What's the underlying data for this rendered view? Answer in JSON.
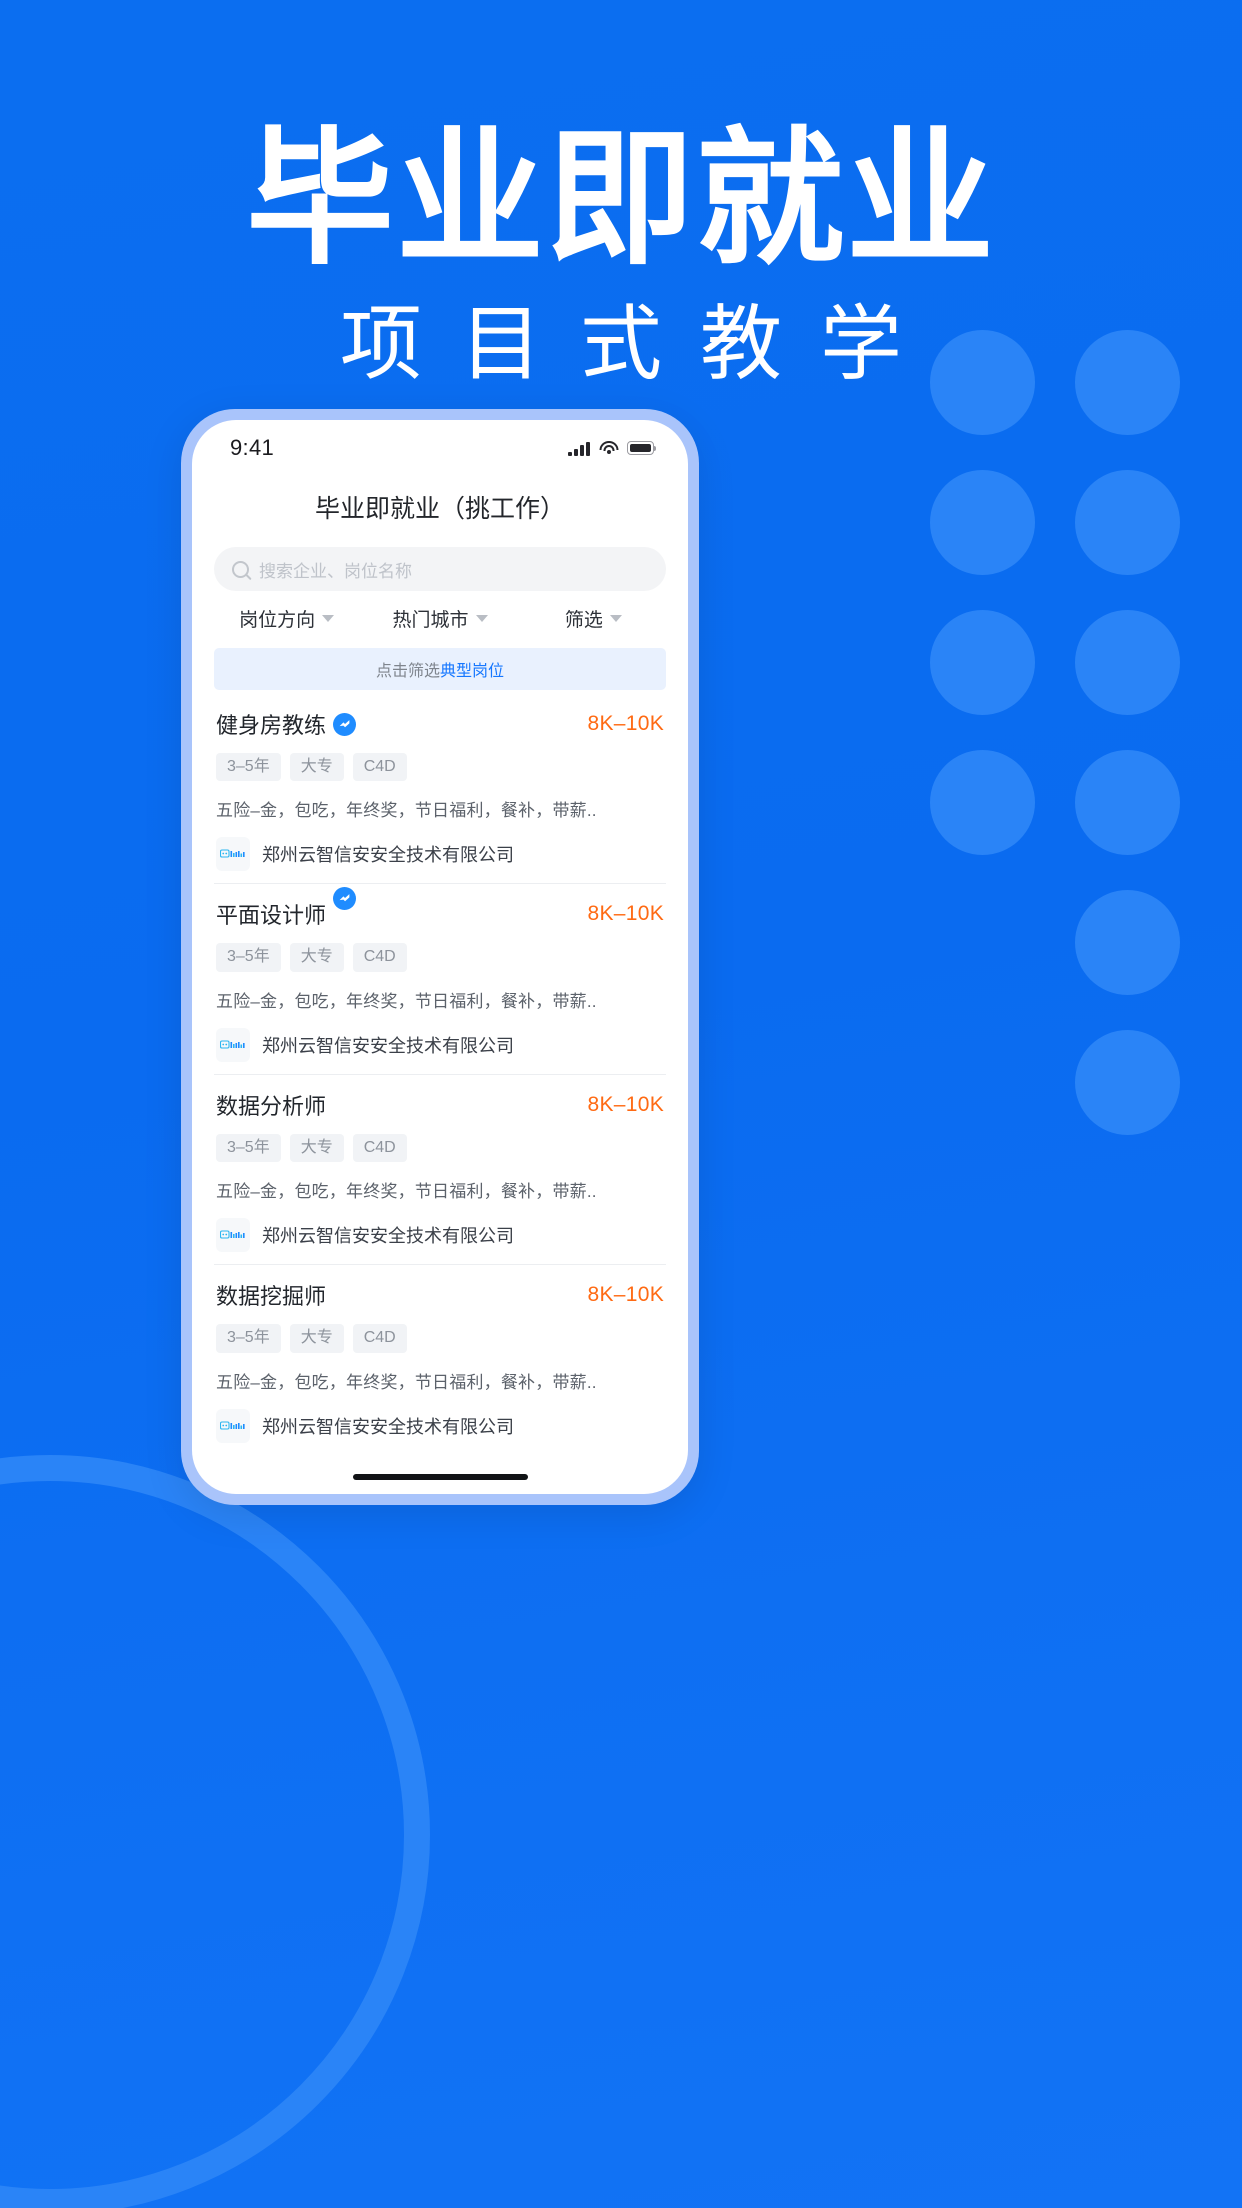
{
  "poster": {
    "title_main": "毕业即就业",
    "title_sub": "项目式教学",
    "bg_color": "#0b6ef0",
    "accent_color": "#2a84f7"
  },
  "phone": {
    "status_bar": {
      "time": "9:41",
      "signal_icon": "signal-bars-icon",
      "wifi_icon": "wifi-icon",
      "battery_icon": "battery-icon"
    },
    "nav_title": "毕业即就业（挑工作）",
    "search": {
      "icon": "search-icon",
      "placeholder": "搜索企业、岗位名称",
      "value": ""
    },
    "filters": [
      {
        "label": "岗位方向",
        "icon": "chevron-down-icon"
      },
      {
        "label": "热门城市",
        "icon": "chevron-down-icon"
      },
      {
        "label": "筛选",
        "icon": "chevron-down-icon"
      }
    ],
    "banner": {
      "text_grey": "点击筛选",
      "text_blue": "典型岗位"
    },
    "jobs": [
      {
        "title": "健身房教练",
        "verified": true,
        "badge_raised": false,
        "salary": "8K–10K",
        "tags": [
          "3–5年",
          "大专",
          "C4D"
        ],
        "benefits": "五险–金，包吃，年终奖，节日福利，餐补，带薪..",
        "company": "郑州云智信安安全技术有限公司",
        "company_logo": "company-logo-icon"
      },
      {
        "title": "平面设计师",
        "verified": true,
        "badge_raised": true,
        "salary": "8K–10K",
        "tags": [
          "3–5年",
          "大专",
          "C4D"
        ],
        "benefits": "五险–金，包吃，年终奖，节日福利，餐补，带薪..",
        "company": "郑州云智信安安全技术有限公司",
        "company_logo": "company-logo-icon"
      },
      {
        "title": "数据分析师",
        "verified": false,
        "badge_raised": false,
        "salary": "8K–10K",
        "tags": [
          "3–5年",
          "大专",
          "C4D"
        ],
        "benefits": "五险–金，包吃，年终奖，节日福利，餐补，带薪..",
        "company": "郑州云智信安安全技术有限公司",
        "company_logo": "company-logo-icon"
      },
      {
        "title": "数据挖掘师",
        "verified": false,
        "badge_raised": false,
        "salary": "8K–10K",
        "tags": [
          "3–5年",
          "大专",
          "C4D"
        ],
        "benefits": "五险–金，包吃，年终奖，节日福利，餐补，带薪..",
        "company": "郑州云智信安安全技术有限公司",
        "company_logo": "company-logo-icon"
      }
    ],
    "home_indicator": "home-indicator"
  }
}
